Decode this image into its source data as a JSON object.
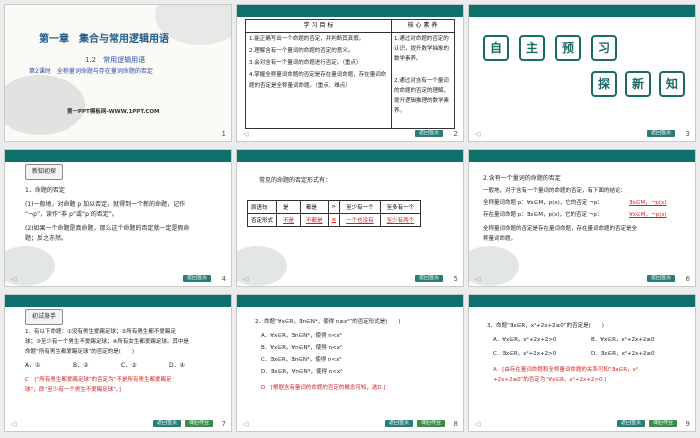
{
  "slides": [
    {
      "n": "1",
      "chapter": "第一章　集合与常用逻辑用语",
      "section": "1.2　常用逻辑用语",
      "lesson": "第2课时　全称量词命题与存在量词命题的否定",
      "footer": "第一PPT模板网-WWW.1PPT.COM"
    },
    {
      "n": "2",
      "headers": [
        "学 习 目 标",
        "核 心 素 养"
      ],
      "goals": [
        "1.能正确写出一个命题的否定，并判断其真假。",
        "2.理解含有一个量词的命题的否定的意义。",
        "3.会对含有一个量词的命题进行否定。（重点）",
        "4.掌握全称量词命题的否定是存在量词命题，存在量词命题的否定是全称量词命题。（重点、难点）"
      ],
      "core": [
        "1.通过对命题的否定的认识，提升数学抽象的数学素养。",
        "2.通过对含有一个量词的命题的否定的理解，提升逻辑推理的数学素养。"
      ]
    },
    {
      "n": "3",
      "chars": [
        "自",
        "主",
        "预",
        "习",
        "探",
        "新",
        "知"
      ]
    },
    {
      "n": "4",
      "tag": "新知初探",
      "title": "1．命题的否定",
      "lines": [
        "(1)一般地，对命题 p 加以否定，就得到一个新的命题，记作",
        "“¬p”，读作“非 p”或“p 的否定”。",
        "(2)如果一个命题是真命题，那么这个命题的否定就一定是假命",
        "题；反之亦然。"
      ]
    },
    {
      "n": "5",
      "intro": "常见的命题的否定形式有：",
      "row1": [
        "原语句",
        "是",
        "都是",
        ">",
        "至少有一个",
        "至多有一个"
      ],
      "row2": [
        "否定形式",
        "不是",
        "不都是",
        "≤",
        "一个也没有",
        "至少有两个"
      ]
    },
    {
      "n": "6",
      "title": "2.含有一个量词的命题的否定",
      "lines": [
        "一般地，对于含有一个量词的命题的否定，有下面的结论：",
        "全称量词命题 p：∀x∈M，p(x)，它的否定 ¬p：",
        "存在量词命题 p：∃x∈M，p(x)，它的否定 ¬p：",
        "全称量词命题的否定是存在量词命题，存在量词命题的否定是全",
        "称量词命题。"
      ],
      "a1": "∃x∈M，¬p(x)",
      "a2": "∀x∈M，¬p(x)"
    },
    {
      "n": "7",
      "tag": "初试身手",
      "lines": [
        "1．有以下命题：①没有男生爱踢足球；②所有男生都不爱踢足",
        "球；③至少有一个男生不爱踢足球；④所有女生都爱踢足球。其中是",
        "命题“所有男生都爱踢足球”的否定的是(　　)"
      ],
      "opts": [
        "A．①",
        "B．②",
        "C．③",
        "D．④"
      ],
      "ans": [
        "C　[“所有男生都爱踢足球”的否定为“不是所有男生都爱踢足",
        "球”，即“至少有一个男生不爱踢足球”。]"
      ]
    },
    {
      "n": "8",
      "q": "2．命题“∀x∈R，∃n∈N*，使得 n≥x²”的否定形式是(　　)",
      "opts": [
        "A．∀x∈R，∃n∈N*，使得 n<x²",
        "B．∀x∈R，∀n∈N*，使得 n<x²",
        "C．∃x∈R，∃n∈N*，使得 n<x²",
        "D．∃x∈R，∀n∈N*，使得 n<x²"
      ],
      "ans": "D　[根据含有量词的命题的否定的概念可知，选D.]"
    },
    {
      "n": "9",
      "q": "3．命题“∃x∈R，x²+2x+2≤0”的否定是(　　)",
      "opts": [
        "A．∀x∈R，x²+2x+2>0",
        "B．∀x∈R，x²+2x+2≤0",
        "C．∃x∈R，x²+2x+2>0",
        "D．∃x∈R，x²+2x+2≥0"
      ],
      "ans": [
        "A　[由存在量词命题和全称量词命题的关系可知“∃x∈R，x²",
        "+2x+2≤0”的否定为“∀x∈R，x²+2x+2>0.]"
      ]
    }
  ],
  "labels": {
    "prev": "◁",
    "footer_btn": "返回首页",
    "footer_btn2": "课后作业"
  }
}
